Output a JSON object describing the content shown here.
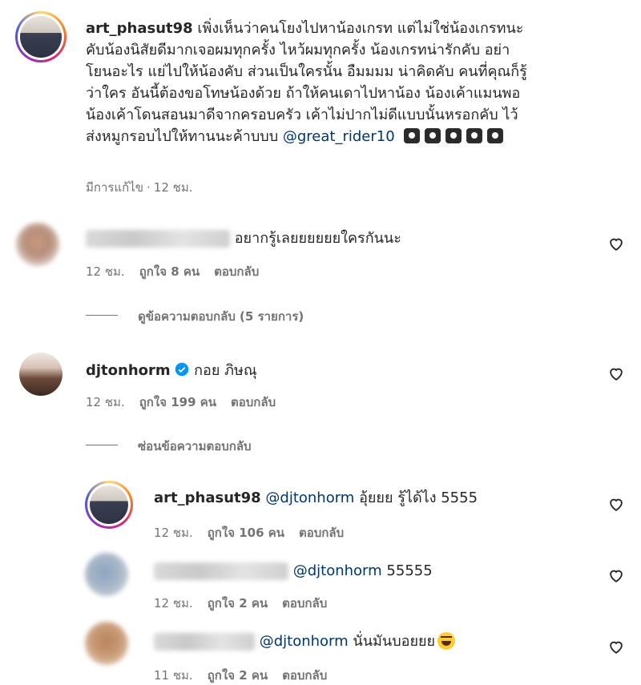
{
  "main_comment": {
    "username": "art_phasut98",
    "lines": [
      "เพิ่งเห็นว่าคนโยงไปหาน้องเกรท แต่ไม่ใช่น้องเกรทนะ",
      "คับน้องนิสัยดีมากเจอผมทุกครั้ง ไหว้ผมทุกครั้ง น้องเกรทน่ารักคับ อย่า",
      "โยนอะไร แย่ไปให้น้องคับ ส่วนเป็นใครนั้น อืมมมม น่าคิดคับ คนที่คุณก็รู้",
      "ว่าใคร อันนี้ต้องขอโทษน้องด้วย ถ้าให้คนเดาไปหาน้อง น้องเค้าแมนพอ",
      "น้องเค้าโดนสอนมาดีจากครอบครัว เค้าไม่ปากไม่ดีแบบนั้นหรอกคับ ไว้",
      "ส่งหมูกรอบไปให้ทานนะค้าบบบ"
    ],
    "mention": "@great_rider10",
    "emoji_name": "camera-emoji",
    "edited": "มีการแก้ไข",
    "separator": "·",
    "time": "12 ชม."
  },
  "comment1": {
    "text": "อยากรู้เลยยยยยยใครกันนะ",
    "time": "12 ชม.",
    "likes": "ถูกใจ 8 คน",
    "reply": "ตอบกลับ",
    "view_replies": "ดูข้อความตอบกลับ (5 รายการ)"
  },
  "comment2": {
    "username": "djtonhorm",
    "text": "กอย ภิษณุ",
    "time": "12 ชม.",
    "likes": "ถูกใจ 199 คน",
    "reply": "ตอบกลับ",
    "hide_replies": "ซ่อนข้อความตอบกลับ",
    "verified_color": "#0095f6"
  },
  "replies": [
    {
      "username": "art_phasut98",
      "mention": "@djtonhorm",
      "text": "อุ้ยยย รู้ได้ไง 5555",
      "time": "12 ชม.",
      "likes": "ถูกใจ 106 คน",
      "reply": "ตอบกลับ"
    },
    {
      "username": "",
      "mention": "@djtonhorm",
      "text": "55555",
      "time": "12 ชม.",
      "likes": "ถูกใจ 2 คน",
      "reply": "ตอบกลับ"
    },
    {
      "username": "",
      "mention": "@djtonhorm",
      "text": "นั่นมันบอยยย",
      "emoji_name": "laughing-emoji",
      "time": "11 ชม.",
      "likes": "ถูกใจ 2 คน",
      "reply": "ตอบกลับ"
    }
  ],
  "colors": {
    "mention": "#00376b",
    "muted": "#737373",
    "text": "#262626"
  }
}
